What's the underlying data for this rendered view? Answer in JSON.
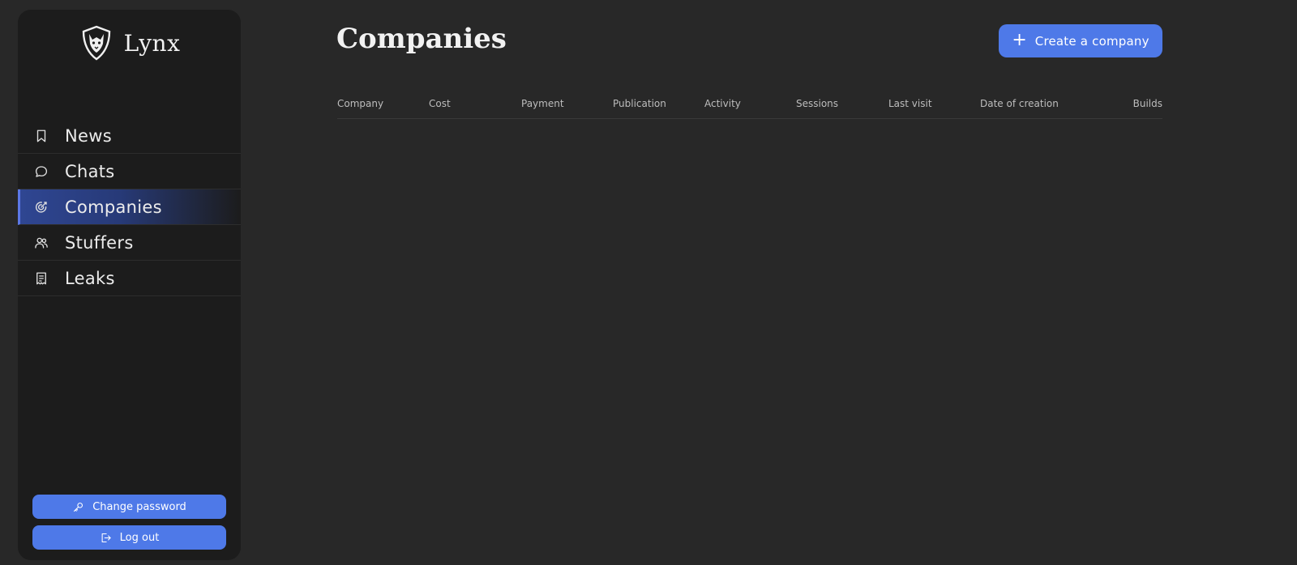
{
  "app": {
    "name": "Lynx",
    "logo_icon": "lynx-shield-icon"
  },
  "sidebar": {
    "items": [
      {
        "label": "News",
        "icon": "bookmark-icon",
        "active": false
      },
      {
        "label": "Chats",
        "icon": "chat-bubble-icon",
        "active": false
      },
      {
        "label": "Companies",
        "icon": "target-icon",
        "active": true
      },
      {
        "label": "Stuffers",
        "icon": "users-icon",
        "active": false
      },
      {
        "label": "Leaks",
        "icon": "receipt-icon",
        "active": false
      }
    ],
    "change_password_label": "Change password",
    "logout_label": "Log out"
  },
  "main": {
    "title": "Companies",
    "create_button_label": "Create a company",
    "table": {
      "columns": [
        "Company",
        "Cost",
        "Payment",
        "Publication",
        "Activity",
        "Sessions",
        "Last visit",
        "Date of creation",
        "Builds"
      ],
      "rows": []
    }
  },
  "colors": {
    "accent": "#4e79e8",
    "background": "#282828",
    "sidebar": "#1c1c1c",
    "active_item": "#2f4692"
  }
}
